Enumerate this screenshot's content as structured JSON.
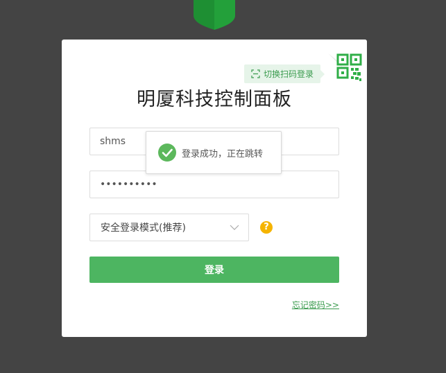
{
  "colors": {
    "background": "#444444",
    "brand_green": "#4db561",
    "link_green": "#3a9b4e",
    "shield_green": "#1e8f33",
    "help_yellow": "#f5b400"
  },
  "header": {
    "logo_icon": "shield-logo-icon"
  },
  "card": {
    "title": "明厦科技控制面板",
    "scan_tip": "切换扫码登录",
    "qr_icon": "qr-code-icon",
    "username_value": "shms",
    "password_value": "••••••••••",
    "login_mode_selected": "安全登录模式(推荐)",
    "help_symbol": "?",
    "login_button_label": "登录",
    "forgot_link": "忘记密码>>"
  },
  "toast": {
    "icon": "success-check-icon",
    "message": "登录成功，正在跳转"
  }
}
